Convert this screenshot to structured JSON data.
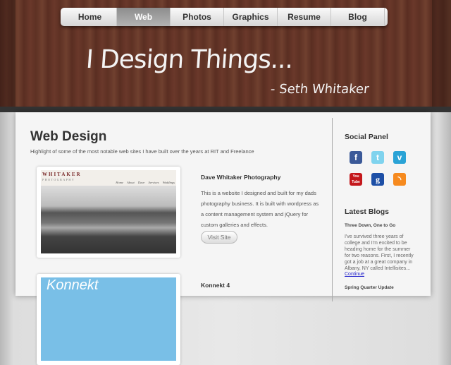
{
  "nav": {
    "items": [
      "Home",
      "Web",
      "Photos",
      "Graphics",
      "Resume",
      "Blog"
    ],
    "active": "Web"
  },
  "header": {
    "tagline": "I Design Things...",
    "signature": "- Seth Whitaker"
  },
  "main": {
    "title": "Web Design",
    "subtitle": "Highlight of some of the most notable web sites I have built over the years at RIT and Freelance",
    "projects": [
      {
        "title": "Dave Whitaker Photography",
        "description": "This is a website I designed and built for my dads photography business. It is built with wordpress as a content management system and jQuery for custom galleries and effects.",
        "button": "Visit Site",
        "shot_brand": "WHITAKER",
        "shot_sub": "PHOTOGRAPHY",
        "shot_nav": "Home About Dave Services Weddings"
      },
      {
        "title": "Konnekt 4",
        "shot_brand": "Konnekt"
      }
    ]
  },
  "sidebar": {
    "social_title": "Social Panel",
    "social": [
      "facebook",
      "twitter",
      "vimeo",
      "youtube",
      "google",
      "rss"
    ],
    "blogs_title": "Latest Blogs",
    "blogs": [
      {
        "title": "Three Down, One to Go",
        "excerpt": "I've survived three years of college and I'm excited to be heading home for the summer for two reasons. First, I recently got a job at a great company in Albany, NY called Intellisites...",
        "link": "Continue"
      },
      {
        "title": "Spring Quarter Update"
      }
    ]
  },
  "colors": {
    "wood": "#5e3124",
    "active_tab": "#999999",
    "link": "#2222cc"
  }
}
